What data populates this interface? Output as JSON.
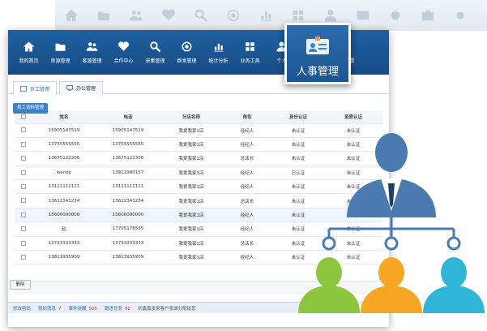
{
  "nav": [
    {
      "label": "我的首页",
      "icon": "home-icon"
    },
    {
      "label": "房源管理",
      "icon": "folder-icon"
    },
    {
      "label": "客源管理",
      "icon": "users-icon"
    },
    {
      "label": "合作中心",
      "icon": "handshake-icon"
    },
    {
      "label": "采集管理",
      "icon": "magnifier-icon"
    },
    {
      "label": "群发管理",
      "icon": "broadcast-icon"
    },
    {
      "label": "统计分析",
      "icon": "bar-chart-icon"
    },
    {
      "label": "业务工具",
      "icon": "grid-icon"
    },
    {
      "label": "个人",
      "icon": "person-icon"
    },
    {
      "label": "",
      "icon": "blank"
    },
    {
      "label": "系统设置",
      "icon": "gear-icon"
    }
  ],
  "highlight": {
    "label": "人事管理",
    "icon": "id-card-icon"
  },
  "tabs": [
    {
      "label": "员工管理",
      "active": true
    },
    {
      "label": "办公管理",
      "active": false
    }
  ],
  "subtab": "员工资料管理",
  "table": {
    "headers": [
      "姓名",
      "电话",
      "分店名称",
      "角色",
      "身份认证",
      "资质认证"
    ],
    "rows": [
      {
        "name": "15905147519",
        "phone": "15905147519",
        "branch": "我爱我家1店",
        "role": "经纪人",
        "id_cert": "未认证",
        "qual_cert": "未认证",
        "id_status": "gray",
        "highlight": false
      },
      {
        "name": "13755555555",
        "phone": "13755555555",
        "branch": "我爱我家1店",
        "role": "经纪人",
        "id_cert": "未认证",
        "qual_cert": "未认证",
        "id_status": "gray",
        "highlight": false
      },
      {
        "name": "13675122306",
        "phone": "13675122306",
        "branch": "我爱我家1店",
        "role": "总店长",
        "id_cert": "未认证",
        "qual_cert": "未认证",
        "id_status": "gray",
        "highlight": false
      },
      {
        "name": "wendy",
        "phone": "13912980157",
        "branch": "我爱我家1店",
        "role": "经纪人",
        "id_cert": "已认证",
        "qual_cert": "未认证",
        "id_status": "green",
        "highlight": false
      },
      {
        "name": "13111111111",
        "phone": "13111111111",
        "branch": "我爱我家1店",
        "role": "经纪人",
        "id_cert": "未认证",
        "qual_cert": "未认证",
        "id_status": "gray",
        "highlight": false
      },
      {
        "name": "13612341234",
        "phone": "13612341234",
        "branch": "我爱我家1店",
        "role": "总店长",
        "id_cert": "未认证",
        "qual_cert": "未认证",
        "id_status": "gray",
        "highlight": false
      },
      {
        "name": "15600000000",
        "phone": "15600000000",
        "branch": "我爱我家1店",
        "role": "经纪人",
        "id_cert": "未认证",
        "qual_cert": "未认证",
        "id_status": "gray",
        "highlight": true
      },
      {
        "name": "赵",
        "phone": "17705176535",
        "branch": "我爱我家1店",
        "role": "经纪人",
        "id_cert": "未认证",
        "qual_cert": "未认证",
        "id_status": "gray",
        "highlight": false
      },
      {
        "name": "13733333333",
        "phone": "13733333333",
        "branch": "我爱我家1店",
        "role": "总店长",
        "id_cert": "未认证",
        "qual_cert": "未认证",
        "id_status": "gray",
        "highlight": false
      },
      {
        "name": "13813935909",
        "phone": "13813935909",
        "branch": "我爱我家1店",
        "role": "经纪人",
        "id_cert": "未认证",
        "qual_cert": "未认证",
        "id_status": "gray",
        "highlight": false
      }
    ]
  },
  "delete_label": "删除",
  "status": {
    "items": [
      {
        "label": "修改密码",
        "count": ""
      },
      {
        "label": "我的消息",
        "count": "7"
      },
      {
        "label": "事件提醒",
        "count": "505"
      },
      {
        "label": "跟进任务",
        "count": "52"
      }
    ],
    "message": "刘鑫鑫发来客户张诚分配给您"
  },
  "colors": {
    "nav": "#1f5fa0",
    "accent": "#3b83c9",
    "person_blue": "#4a7ab0",
    "person_green": "#8cc63f",
    "person_orange": "#f5a623",
    "person_cyan": "#2eb5d8"
  }
}
